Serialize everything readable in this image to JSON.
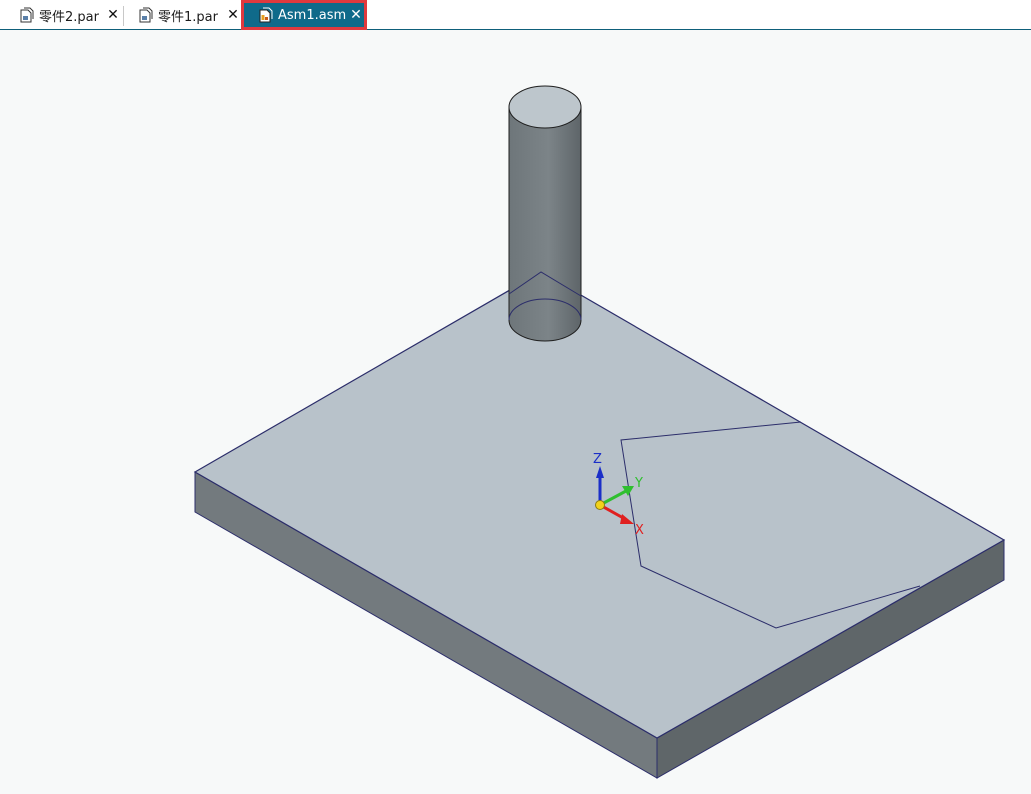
{
  "tabs": [
    {
      "label": "零件2.par",
      "close": "✕",
      "active": false
    },
    {
      "label": "零件1.par",
      "close": "✕",
      "active": false
    },
    {
      "label": "Asm1.asm",
      "close": "✕",
      "active": true
    }
  ],
  "triad": {
    "x_label": "X",
    "y_label": "Y",
    "z_label": "Z",
    "x_color": "#e02020",
    "y_color": "#2fbf2f",
    "z_color": "#1a2ec8"
  },
  "colors": {
    "active_tab": "#0f6a8a",
    "highlight": "#e0393e",
    "plate_top": "#b8c2ca",
    "plate_side": "#737a7e",
    "edge": "#2b2d6a",
    "background": "#f7f9f9"
  }
}
